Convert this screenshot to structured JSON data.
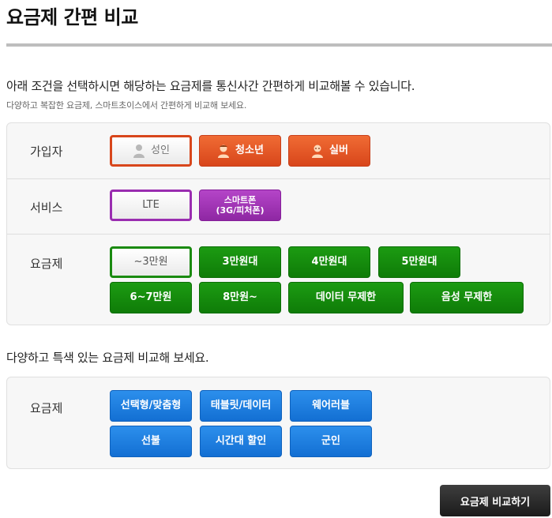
{
  "page": {
    "title": "요금제 간편 비교",
    "intro": "아래 조건을 선택하시면 해당하는 요금제를 통신사간 간편하게 비교해볼 수 있습니다.",
    "sub": "다양하고 복잡한 요금제, 스마트초이스에서 간편하게 비교해 보세요.",
    "section2_title": "다양하고 특색 있는 요금제 비교해 보세요."
  },
  "subscriber": {
    "label": "가입자",
    "options": [
      "성인",
      "청소년",
      "실버"
    ],
    "selected": "성인"
  },
  "service": {
    "label": "서비스",
    "options": [
      "LTE",
      "스마트폰\n(3G/피처폰)"
    ],
    "selected": "LTE"
  },
  "plan": {
    "label": "요금제",
    "options": [
      "~3만원",
      "3만원대",
      "4만원대",
      "5만원대",
      "6~7만원",
      "8만원~",
      "데이터 무제한",
      "음성 무제한"
    ],
    "selected": "~3만원"
  },
  "special": {
    "label": "요금제",
    "options": [
      "선택형/맞춤형",
      "태블릿/데이터",
      "웨어러블",
      "선불",
      "시간대 할인",
      "군인"
    ]
  },
  "compare_button": "요금제 비교하기",
  "colors": {
    "subscriber": "#e4552a",
    "service": "#9b2fb1",
    "plan": "#158b0c",
    "special": "#1a7ae0",
    "compare": "#2a2a2a"
  },
  "icons": {
    "adult": "person-icon",
    "youth": "youth-icon",
    "senior": "senior-icon"
  }
}
